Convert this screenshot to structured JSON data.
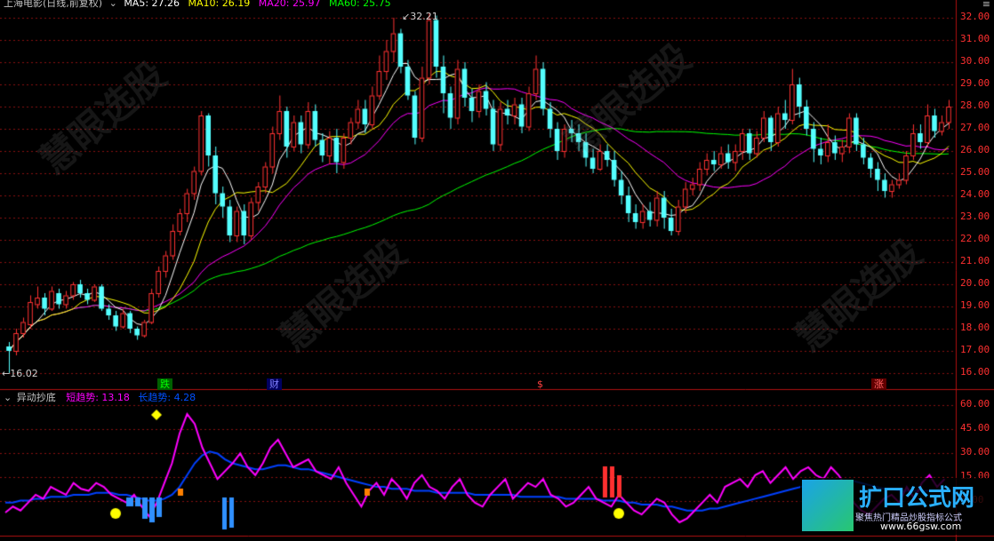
{
  "title": {
    "stock": "上海电影(日线,前复权)",
    "ma5": "MA5: 27.26",
    "ma10": "MA10: 26.19",
    "ma20": "MA20: 25.97",
    "ma60": "MA60: 25.75"
  },
  "indicator": {
    "name": "异动抄底",
    "short": "短趋势: 13.18",
    "long": "长趋势: 4.28"
  },
  "price_axis": [
    "32.00",
    "31.00",
    "30.00",
    "29.00",
    "28.00",
    "27.00",
    "26.00",
    "25.00",
    "24.00",
    "23.00",
    "22.00",
    "21.00",
    "20.00",
    "19.00",
    "18.00",
    "17.00",
    "16.00"
  ],
  "ind_axis": [
    "60.00",
    "45.00",
    "30.00",
    "15.00",
    "0.00"
  ],
  "annotations": {
    "high": "32.21",
    "low": "16.02",
    "m1": "跌",
    "m2": "财",
    "m3": "$",
    "m4": "涨"
  },
  "watermark": {
    "text": "慧眼选股",
    "site": "www.66gsw.com"
  },
  "logo": {
    "title": "扩口公式网",
    "sub": "聚焦热门精品炒股指标公式",
    "url": "www.66gsw.com"
  },
  "colors": {
    "up": "#ff3232",
    "down": "#54ffff",
    "ma5": "#ffffff",
    "ma10": "#ffff00",
    "ma20": "#ff00ff",
    "ma60": "#00ff00",
    "grid": "#8a1010",
    "short": "#ff00ff",
    "long": "#0040ff"
  },
  "chart_data": {
    "type": "candlestick",
    "ylim": [
      15.5,
      32.5
    ],
    "candles": [
      [
        17.2,
        17.0,
        17.4,
        16.0
      ],
      [
        17.0,
        17.8,
        18.0,
        16.8
      ],
      [
        17.8,
        18.3,
        18.5,
        17.6
      ],
      [
        18.2,
        19.2,
        19.5,
        18.0
      ],
      [
        19.1,
        19.4,
        19.9,
        18.9
      ],
      [
        19.4,
        18.9,
        19.6,
        18.6
      ],
      [
        18.9,
        19.7,
        19.9,
        18.8
      ],
      [
        19.6,
        19.1,
        19.8,
        18.9
      ],
      [
        19.1,
        19.5,
        19.7,
        18.9
      ],
      [
        19.5,
        20.0,
        20.1,
        19.3
      ],
      [
        20.0,
        19.6,
        20.2,
        19.4
      ],
      [
        19.6,
        19.3,
        19.8,
        19.1
      ],
      [
        19.3,
        19.9,
        20.0,
        19.2
      ],
      [
        19.9,
        18.9,
        20.0,
        18.8
      ],
      [
        18.9,
        18.6,
        19.1,
        18.4
      ],
      [
        18.6,
        18.1,
        18.8,
        17.9
      ],
      [
        18.1,
        18.7,
        18.9,
        18.0
      ],
      [
        18.7,
        18.0,
        18.8,
        17.8
      ],
      [
        18.0,
        17.7,
        18.1,
        17.5
      ],
      [
        17.7,
        18.3,
        18.4,
        17.6
      ],
      [
        18.3,
        19.6,
        19.8,
        18.2
      ],
      [
        19.6,
        20.6,
        20.8,
        19.4
      ],
      [
        20.6,
        21.3,
        21.5,
        20.3
      ],
      [
        21.3,
        22.4,
        22.7,
        21.1
      ],
      [
        22.4,
        23.2,
        23.4,
        22.2
      ],
      [
        23.2,
        24.1,
        24.3,
        22.8
      ],
      [
        24.1,
        25.1,
        25.3,
        23.8
      ],
      [
        25.1,
        27.6,
        27.8,
        24.9
      ],
      [
        27.6,
        25.8,
        27.7,
        25.3
      ],
      [
        25.8,
        24.1,
        26.2,
        23.6
      ],
      [
        24.1,
        23.5,
        24.4,
        23.0
      ],
      [
        23.5,
        22.2,
        23.8,
        21.9
      ],
      [
        22.2,
        23.3,
        23.5,
        21.9
      ],
      [
        23.3,
        22.2,
        23.6,
        21.8
      ],
      [
        22.2,
        23.7,
        23.9,
        22.0
      ],
      [
        23.7,
        24.4,
        24.6,
        23.3
      ],
      [
        24.4,
        25.3,
        25.5,
        24.1
      ],
      [
        25.3,
        26.8,
        27.1,
        25.0
      ],
      [
        26.8,
        27.8,
        28.5,
        26.5
      ],
      [
        27.8,
        26.2,
        28.0,
        25.7
      ],
      [
        26.2,
        27.3,
        27.6,
        26.0
      ],
      [
        27.3,
        26.3,
        27.6,
        25.9
      ],
      [
        26.3,
        27.8,
        28.2,
        26.1
      ],
      [
        27.8,
        26.5,
        28.1,
        26.2
      ],
      [
        26.5,
        25.8,
        26.8,
        25.5
      ],
      [
        25.8,
        26.6,
        26.9,
        25.4
      ],
      [
        26.6,
        25.5,
        27.0,
        25.0
      ],
      [
        25.5,
        26.6,
        26.8,
        25.2
      ],
      [
        26.6,
        27.3,
        27.5,
        26.3
      ],
      [
        27.3,
        27.9,
        28.3,
        27.0
      ],
      [
        27.9,
        27.2,
        28.3,
        26.8
      ],
      [
        27.2,
        28.5,
        28.9,
        27.0
      ],
      [
        28.5,
        29.6,
        30.3,
        28.3
      ],
      [
        29.6,
        30.5,
        31.0,
        29.2
      ],
      [
        30.5,
        31.3,
        32.0,
        30.0
      ],
      [
        31.3,
        29.8,
        31.5,
        29.5
      ],
      [
        29.8,
        28.5,
        30.1,
        28.3
      ],
      [
        28.5,
        26.6,
        28.7,
        26.3
      ],
      [
        26.6,
        29.3,
        29.8,
        26.4
      ],
      [
        29.3,
        31.9,
        32.21,
        29.0
      ],
      [
        31.9,
        29.8,
        32.1,
        29.3
      ],
      [
        29.8,
        28.6,
        30.3,
        27.7
      ],
      [
        28.6,
        27.5,
        28.9,
        27.0
      ],
      [
        27.5,
        29.7,
        30.1,
        27.2
      ],
      [
        29.7,
        28.4,
        30.0,
        28.0
      ],
      [
        28.4,
        27.8,
        28.8,
        27.3
      ],
      [
        27.8,
        28.7,
        29.0,
        27.5
      ],
      [
        28.7,
        27.9,
        29.1,
        27.6
      ],
      [
        27.9,
        26.3,
        28.3,
        26.0
      ],
      [
        26.3,
        27.9,
        28.2,
        26.0
      ],
      [
        27.9,
        27.6,
        28.3,
        27.2
      ],
      [
        27.6,
        28.1,
        28.4,
        27.2
      ],
      [
        28.1,
        27.1,
        28.4,
        26.8
      ],
      [
        27.1,
        28.6,
        28.9,
        26.9
      ],
      [
        28.6,
        29.7,
        30.3,
        28.3
      ],
      [
        29.7,
        27.9,
        30.0,
        27.6
      ],
      [
        27.9,
        27.0,
        28.2,
        26.6
      ],
      [
        27.0,
        26.0,
        27.3,
        25.6
      ],
      [
        26.0,
        27.0,
        27.2,
        25.7
      ],
      [
        27.0,
        26.8,
        27.4,
        26.4
      ],
      [
        26.8,
        26.4,
        27.2,
        26.0
      ],
      [
        26.4,
        25.7,
        26.8,
        25.3
      ],
      [
        25.7,
        25.2,
        26.1,
        25.0
      ],
      [
        25.2,
        26.0,
        26.3,
        25.1
      ],
      [
        26.0,
        25.6,
        26.3,
        25.3
      ],
      [
        25.6,
        24.7,
        26.0,
        24.4
      ],
      [
        24.7,
        24.0,
        25.1,
        23.6
      ],
      [
        24.0,
        23.2,
        24.4,
        22.8
      ],
      [
        23.2,
        22.8,
        23.6,
        22.5
      ],
      [
        22.8,
        23.3,
        23.6,
        22.5
      ],
      [
        23.3,
        22.9,
        23.7,
        22.6
      ],
      [
        22.9,
        23.9,
        24.2,
        22.6
      ],
      [
        23.9,
        23.0,
        24.2,
        22.5
      ],
      [
        23.0,
        22.4,
        23.4,
        22.2
      ],
      [
        22.4,
        23.5,
        23.8,
        22.2
      ],
      [
        23.5,
        24.3,
        24.6,
        23.2
      ],
      [
        24.3,
        24.5,
        24.8,
        24.0
      ],
      [
        24.5,
        25.2,
        25.5,
        24.2
      ],
      [
        25.2,
        25.6,
        25.9,
        24.9
      ],
      [
        25.6,
        25.4,
        26.0,
        25.1
      ],
      [
        25.4,
        25.9,
        26.2,
        25.2
      ],
      [
        25.9,
        25.5,
        26.3,
        25.2
      ],
      [
        25.5,
        26.0,
        26.3,
        25.1
      ],
      [
        26.0,
        26.8,
        27.0,
        25.6
      ],
      [
        26.8,
        25.9,
        27.0,
        25.6
      ],
      [
        25.9,
        26.6,
        26.9,
        25.7
      ],
      [
        26.6,
        27.5,
        27.8,
        26.4
      ],
      [
        27.5,
        26.4,
        27.6,
        26.0
      ],
      [
        26.4,
        27.7,
        28.0,
        26.2
      ],
      [
        27.7,
        27.4,
        28.3,
        27.0
      ],
      [
        27.4,
        29.0,
        29.7,
        27.2
      ],
      [
        29.0,
        28.0,
        29.3,
        27.5
      ],
      [
        28.0,
        27.0,
        28.3,
        26.7
      ],
      [
        27.0,
        26.1,
        27.3,
        25.5
      ],
      [
        26.1,
        25.8,
        26.6,
        25.4
      ],
      [
        25.8,
        26.4,
        27.2,
        25.5
      ],
      [
        26.4,
        25.9,
        26.7,
        25.6
      ],
      [
        25.9,
        26.2,
        26.5,
        25.5
      ],
      [
        26.2,
        27.5,
        27.7,
        25.9
      ],
      [
        27.5,
        26.3,
        27.7,
        26.0
      ],
      [
        26.3,
        25.7,
        26.6,
        25.4
      ],
      [
        25.7,
        25.2,
        25.9,
        24.8
      ],
      [
        25.2,
        24.7,
        25.5,
        24.2
      ],
      [
        24.7,
        24.2,
        25.0,
        23.9
      ],
      [
        24.2,
        24.5,
        24.7,
        23.9
      ],
      [
        24.5,
        24.7,
        25.0,
        24.3
      ],
      [
        24.7,
        25.8,
        26.0,
        24.5
      ],
      [
        25.8,
        26.8,
        27.2,
        25.6
      ],
      [
        26.8,
        26.4,
        27.2,
        26.1
      ],
      [
        26.4,
        27.6,
        28.1,
        26.2
      ],
      [
        27.6,
        26.9,
        27.9,
        26.6
      ],
      [
        26.9,
        27.3,
        27.6,
        26.7
      ],
      [
        27.3,
        28.0,
        28.3,
        27.0
      ]
    ],
    "short_trend": [
      5,
      8,
      6,
      10,
      14,
      12,
      18,
      16,
      14,
      20,
      17,
      16,
      20,
      18,
      14,
      12,
      10,
      14,
      8,
      3,
      10,
      20,
      30,
      45,
      55,
      50,
      38,
      30,
      22,
      26,
      30,
      35,
      28,
      24,
      30,
      38,
      42,
      35,
      28,
      30,
      32,
      26,
      24,
      22,
      28,
      20,
      14,
      8,
      16,
      20,
      14,
      22,
      18,
      12,
      20,
      24,
      18,
      16,
      12,
      18,
      22,
      14,
      10,
      8,
      14,
      18,
      22,
      12,
      16,
      20,
      18,
      22,
      14,
      12,
      8,
      10,
      14,
      18,
      12,
      10,
      8,
      14,
      10,
      6,
      4,
      8,
      12,
      10,
      4,
      0,
      2,
      6,
      10,
      14,
      10,
      18,
      20,
      22,
      18,
      24,
      26,
      20,
      24,
      28,
      22,
      26,
      28,
      24,
      22,
      28,
      24,
      18,
      10,
      6,
      4,
      8,
      12,
      14,
      10,
      18,
      12,
      20,
      24,
      18,
      22
    ],
    "long_trend": [
      10,
      10,
      11,
      11,
      12,
      12,
      13,
      13,
      13,
      14,
      14,
      14,
      15,
      15,
      15,
      14,
      14,
      13,
      12,
      11,
      11,
      12,
      14,
      18,
      24,
      30,
      34,
      36,
      35,
      32,
      30,
      29,
      28,
      27,
      27,
      28,
      29,
      29,
      28,
      27,
      27,
      26,
      25,
      24,
      23,
      22,
      21,
      20,
      19,
      18,
      18,
      17,
      17,
      17,
      16,
      16,
      16,
      15,
      15,
      15,
      15,
      15,
      14,
      14,
      14,
      14,
      14,
      14,
      13,
      13,
      13,
      13,
      13,
      13,
      12,
      12,
      12,
      12,
      12,
      11,
      11,
      11,
      10,
      10,
      9,
      9,
      9,
      8,
      8,
      7,
      6,
      6,
      6,
      7,
      7,
      8,
      9,
      10,
      11,
      12,
      13,
      14,
      15,
      16,
      17,
      18,
      19,
      19,
      20,
      20,
      21,
      21,
      21,
      20,
      19,
      18,
      17,
      17,
      16,
      16,
      16,
      16,
      16,
      16,
      16
    ],
    "ind_ylim": [
      -5,
      62
    ]
  }
}
